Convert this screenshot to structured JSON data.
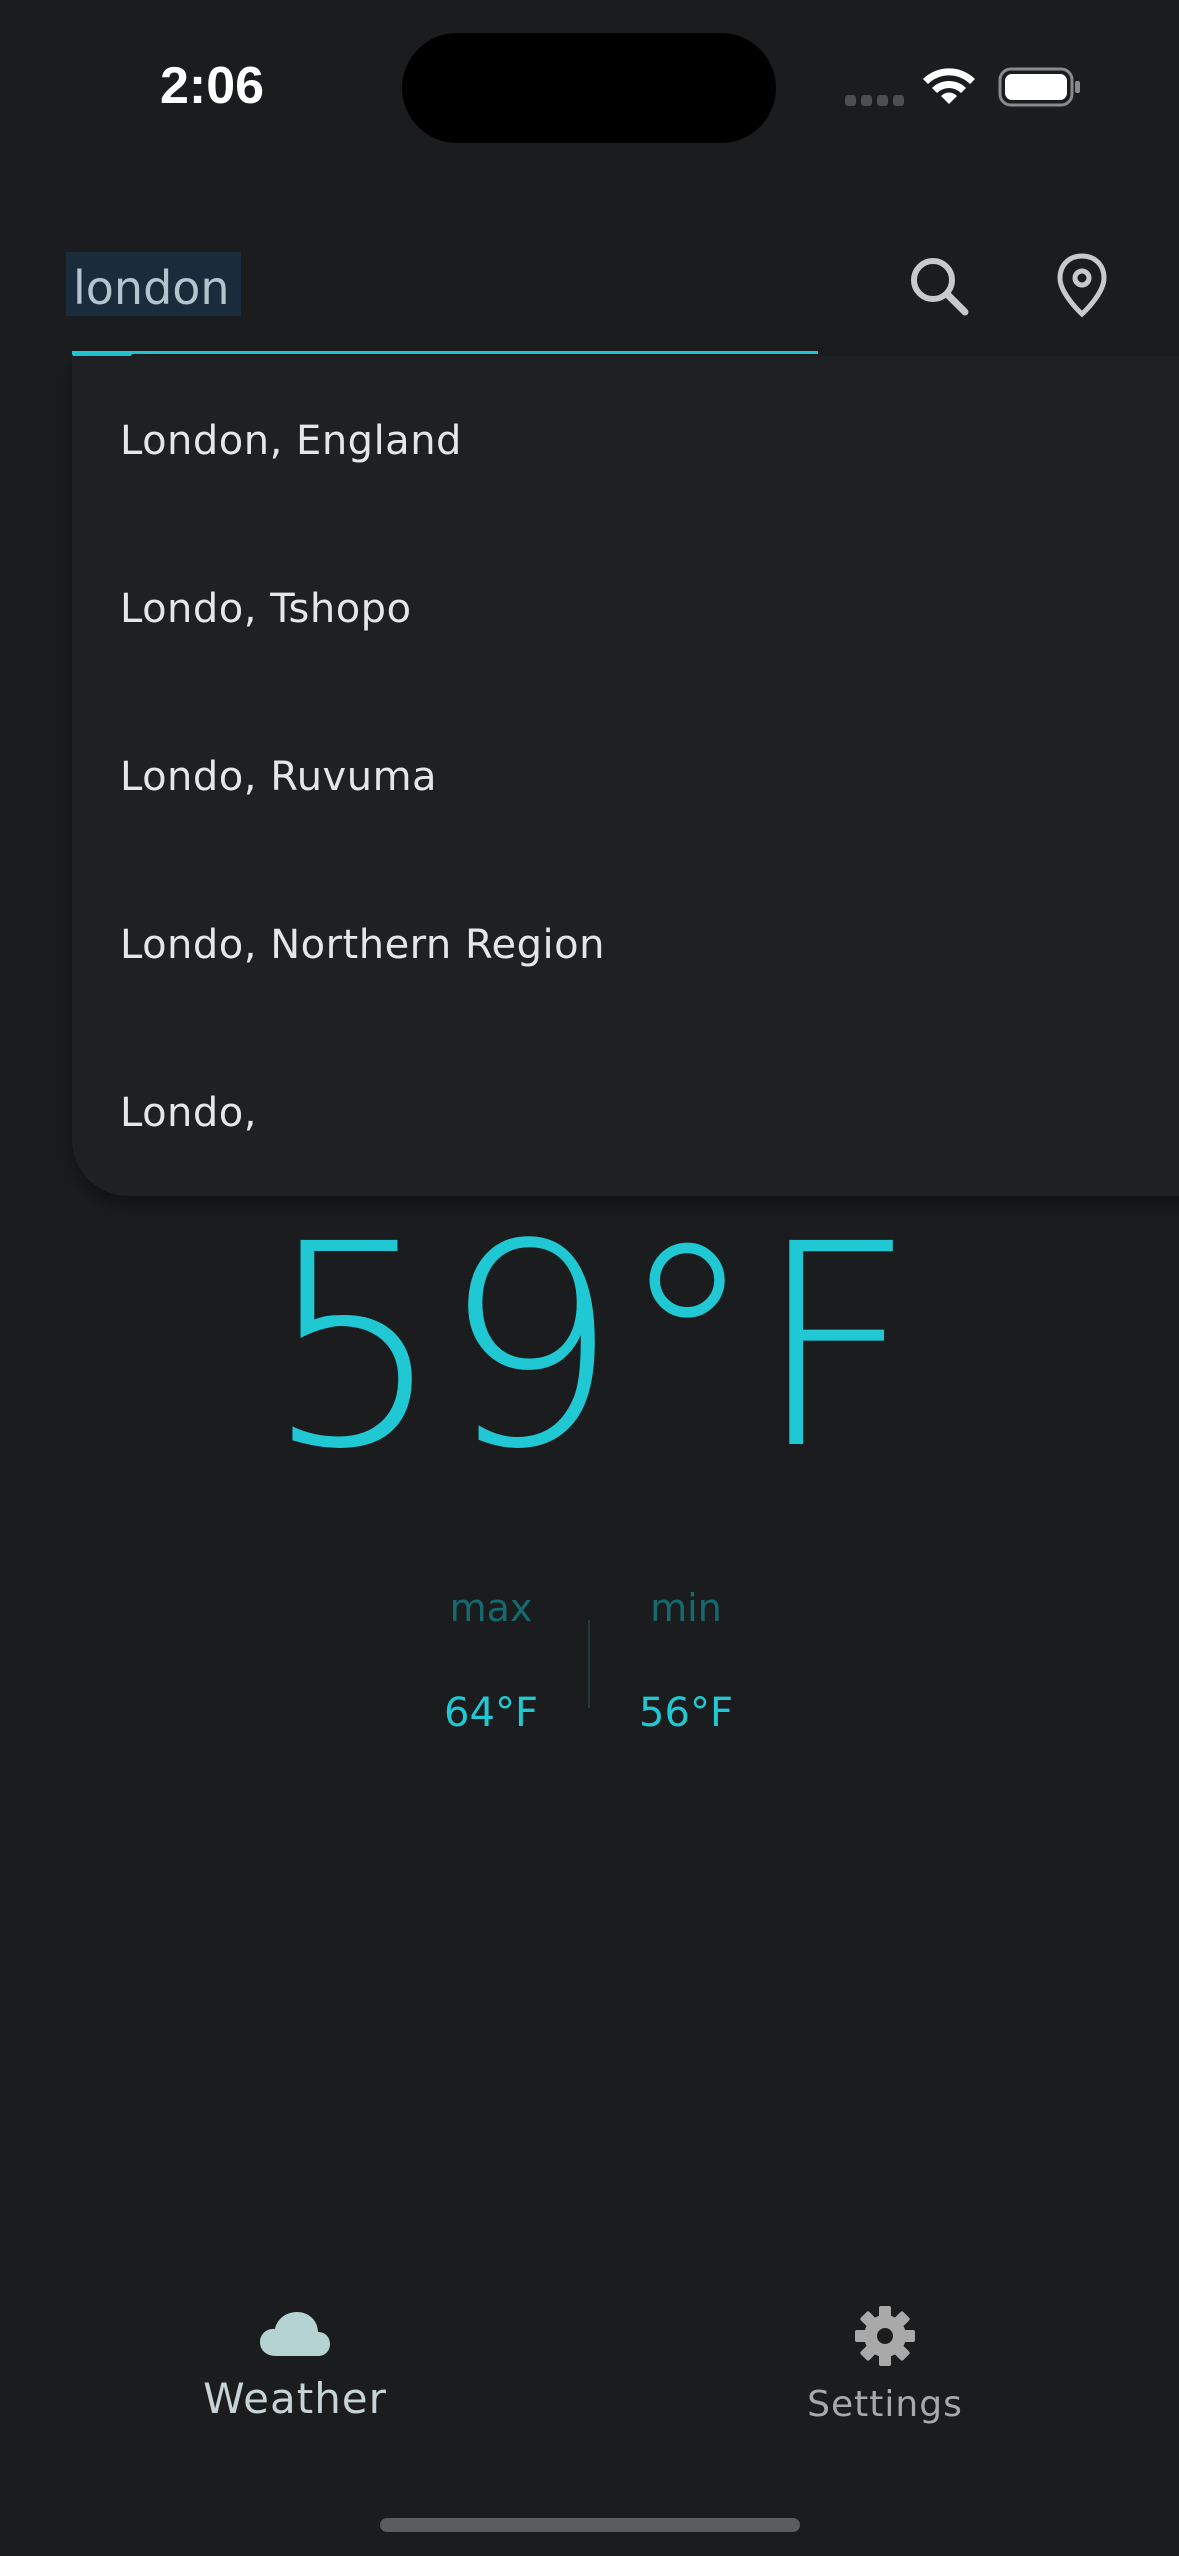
{
  "status_bar": {
    "time": "2:06"
  },
  "search": {
    "value": "london",
    "search_icon": "search-icon",
    "location_icon": "location-pin-icon"
  },
  "suggestions": [
    "London, England",
    "Londo, Tshopo",
    "Londo, Ruvuma",
    "Londo, Northern Region",
    "Londo,"
  ],
  "weather": {
    "temperature": "59°F",
    "max_label": "max",
    "max_value": "64°F",
    "min_label": "min",
    "min_value": "56°F"
  },
  "bottom_nav": {
    "weather_label": "Weather",
    "weather_icon": "cloud-icon",
    "settings_label": "Settings",
    "settings_icon": "gear-icon"
  },
  "colors": {
    "background": "#1a1c1e",
    "accent": "#1fc8d3",
    "dropdown": "#1e2022",
    "muted_accent": "#146a6f"
  }
}
